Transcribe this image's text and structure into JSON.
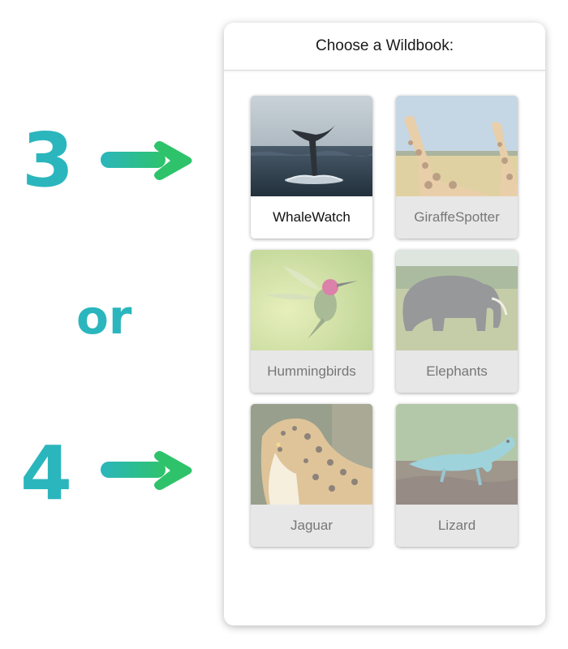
{
  "annotation": {
    "step_a": "3",
    "separator": "or",
    "step_b": "4",
    "accent_color": "#2bb6bd",
    "arrow_gradient": [
      "#2bb6bd",
      "#2ec36a"
    ]
  },
  "panel": {
    "title": "Choose a Wildbook:",
    "cards": [
      {
        "label": "WhaleWatch",
        "image": "whale-tail-photo",
        "state": "active"
      },
      {
        "label": "GiraffeSpotter",
        "image": "giraffe-photo",
        "state": "dimmed"
      },
      {
        "label": "Hummingbirds",
        "image": "hummingbird-photo",
        "state": "dimmed"
      },
      {
        "label": "Elephants",
        "image": "elephant-photo",
        "state": "dimmed"
      },
      {
        "label": "Jaguar",
        "image": "jaguar-photo",
        "state": "dimmed"
      },
      {
        "label": "Lizard",
        "image": "lizard-photo",
        "state": "dimmed"
      }
    ]
  }
}
